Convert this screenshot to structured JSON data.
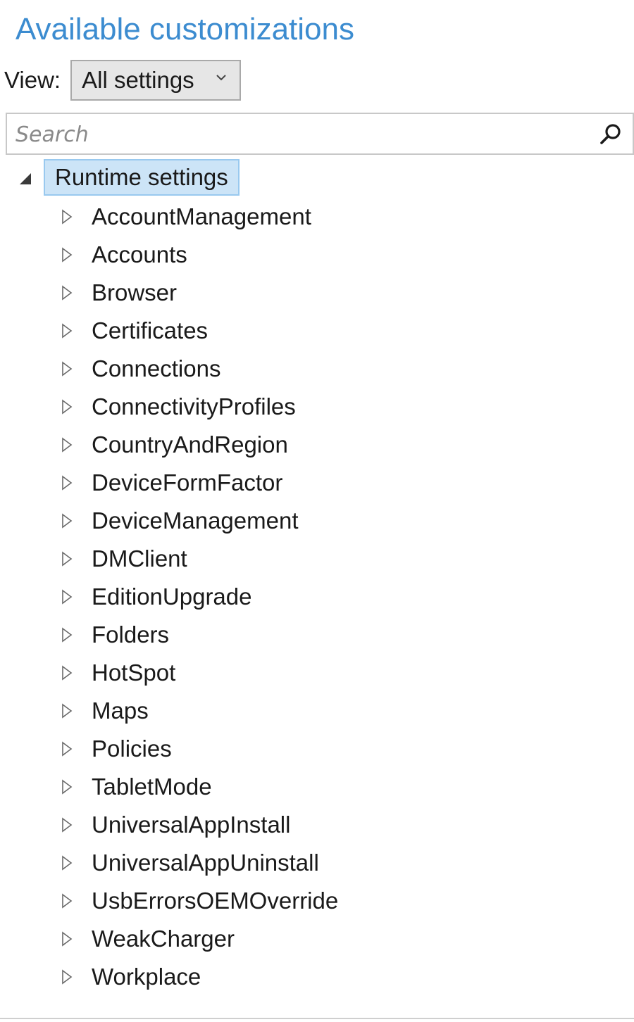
{
  "header": {
    "title": "Available customizations"
  },
  "view": {
    "label": "View:",
    "selected": "All settings",
    "chevron_icon": "chevron-down-icon"
  },
  "search": {
    "placeholder": "Search",
    "value": "",
    "icon": "search-icon"
  },
  "tree": {
    "root": {
      "label": "Runtime settings",
      "expanded": true,
      "selected": true,
      "expander_icon": "collapse-triangle-icon",
      "selection_background": "#cce4f7",
      "selection_border": "#99c9ef"
    },
    "children": [
      {
        "label": "AccountManagement"
      },
      {
        "label": "Accounts"
      },
      {
        "label": "Browser"
      },
      {
        "label": "Certificates"
      },
      {
        "label": "Connections"
      },
      {
        "label": "ConnectivityProfiles"
      },
      {
        "label": "CountryAndRegion"
      },
      {
        "label": "DeviceFormFactor"
      },
      {
        "label": "DeviceManagement"
      },
      {
        "label": "DMClient"
      },
      {
        "label": "EditionUpgrade"
      },
      {
        "label": "Folders"
      },
      {
        "label": "HotSpot"
      },
      {
        "label": "Maps"
      },
      {
        "label": "Policies"
      },
      {
        "label": "TabletMode"
      },
      {
        "label": "UniversalAppInstall"
      },
      {
        "label": "UniversalAppUninstall"
      },
      {
        "label": "UsbErrorsOEMOverride"
      },
      {
        "label": "WeakCharger"
      },
      {
        "label": "Workplace"
      }
    ],
    "child_expander_icon": "expand-triangle-icon"
  },
  "colors": {
    "title": "#3c8cd0",
    "text": "#1a1a1a"
  }
}
